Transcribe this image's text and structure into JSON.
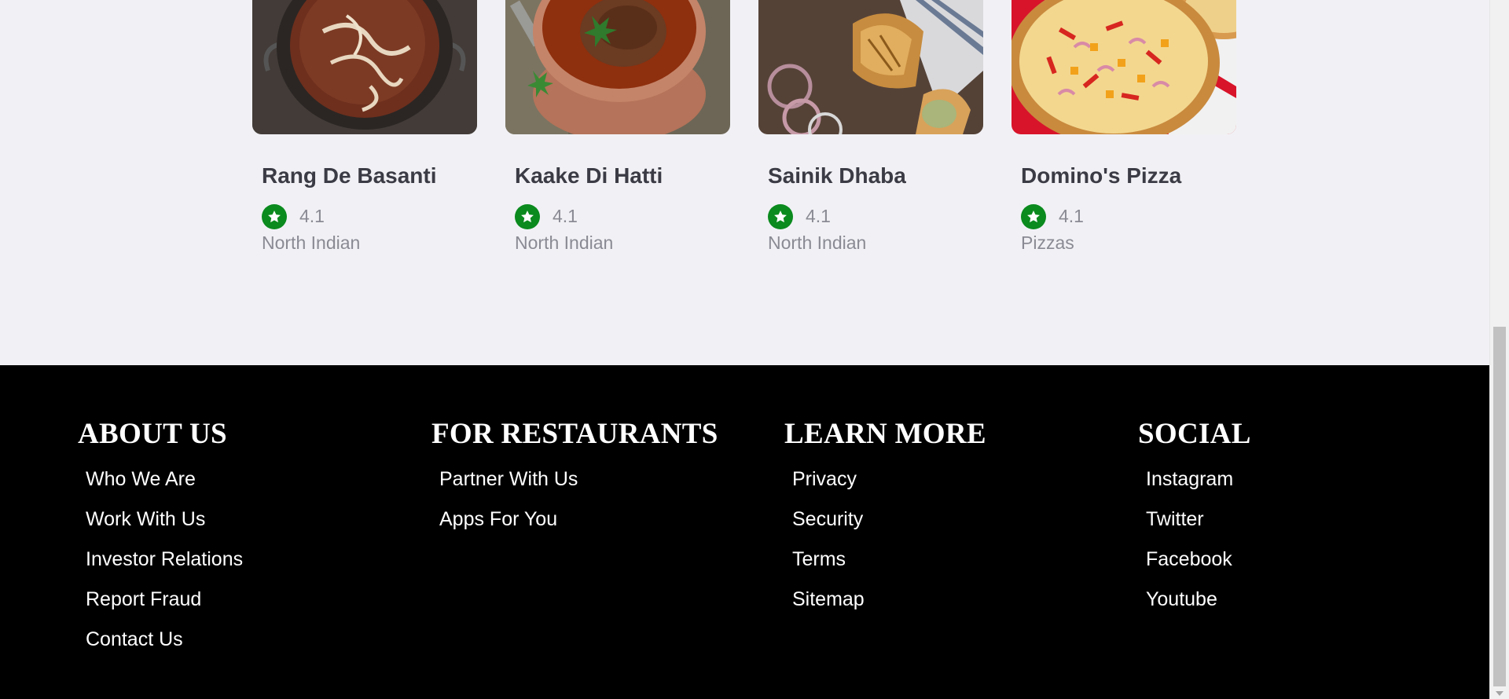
{
  "restaurants": [
    {
      "name": "Rang De Basanti",
      "rating": "4.1",
      "cuisine": "North Indian",
      "image_icon": "dal-makhani-dish-image"
    },
    {
      "name": "Kaake Di Hatti",
      "rating": "4.1",
      "cuisine": "North Indian",
      "image_icon": "curry-pot-dish-image"
    },
    {
      "name": "Sainik Dhaba",
      "rating": "4.1",
      "cuisine": "North Indian",
      "image_icon": "wrap-roll-dish-image"
    },
    {
      "name": "Domino's Pizza",
      "rating": "4.1",
      "cuisine": "Pizzas",
      "image_icon": "pizza-dish-image"
    }
  ],
  "footer": {
    "about": {
      "heading": "ABOUT US",
      "links": [
        "Who We Are",
        "Work With Us",
        "Investor Relations",
        "Report Fraud",
        "Contact Us"
      ]
    },
    "restaurants": {
      "heading": "FOR RESTAURANTS",
      "links": [
        "Partner With Us",
        "Apps For You"
      ]
    },
    "learn": {
      "heading": "LEARN MORE",
      "links": [
        "Privacy",
        "Security",
        "Terms",
        "Sitemap"
      ]
    },
    "social": {
      "heading": "SOCIAL",
      "links": [
        "Instagram",
        "Twitter",
        "Facebook",
        "Youtube"
      ]
    }
  },
  "colors": {
    "page_background": "#f1f1f5",
    "rating_badge": "#0b8a1e",
    "footer_background": "#000000",
    "footer_text": "#ffffff",
    "muted_text": "#8a8a94"
  }
}
